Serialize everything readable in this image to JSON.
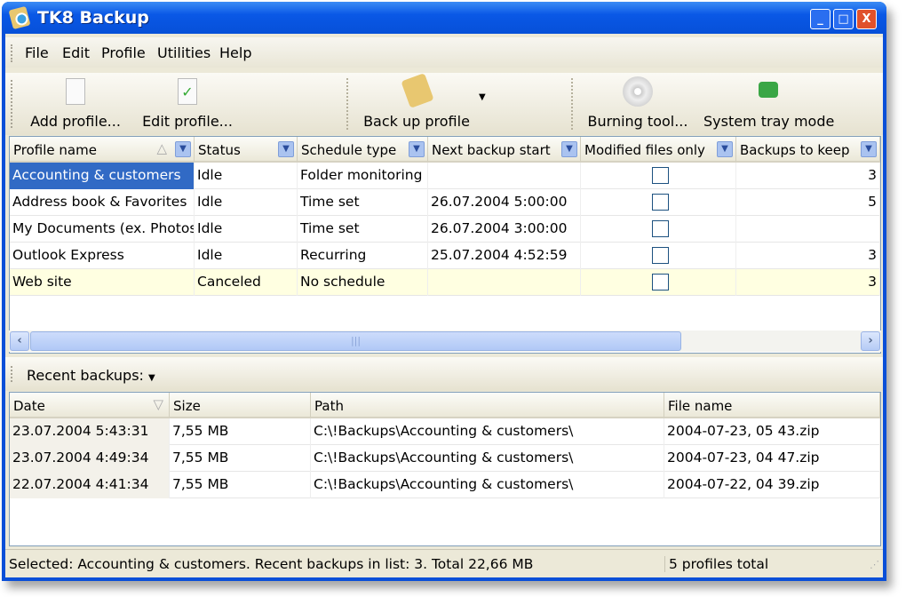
{
  "window": {
    "title": "TK8 Backup"
  },
  "menu": [
    "File",
    "Edit",
    "Profile",
    "Utilities",
    "Help"
  ],
  "toolbar": {
    "add": "Add profile...",
    "edit": "Edit profile...",
    "backup": "Back up profile",
    "burn": "Burning tool...",
    "tray": "System tray mode"
  },
  "profiles": {
    "columns": [
      "Profile name",
      "Status",
      "Schedule type",
      "Next backup start",
      "Modified files only",
      "Backups to keep"
    ],
    "rows": [
      {
        "name": "Accounting & customers",
        "status": "Idle",
        "schedule": "Folder monitoring",
        "next": "",
        "modified": false,
        "keep": "3",
        "selected": true
      },
      {
        "name": "Address book & Favorites",
        "status": "Idle",
        "schedule": "Time set",
        "next": "26.07.2004 5:00:00",
        "modified": false,
        "keep": "5"
      },
      {
        "name": "My Documents (ex. Photos",
        "status": "Idle",
        "schedule": "Time set",
        "next": "26.07.2004 3:00:00",
        "modified": false,
        "keep": ""
      },
      {
        "name": "Outlook Express",
        "status": "Idle",
        "schedule": "Recurring",
        "next": "25.07.2004 4:52:59",
        "modified": false,
        "keep": "3"
      },
      {
        "name": "Web site",
        "status": "Canceled",
        "schedule": "No schedule",
        "next": "",
        "modified": false,
        "keep": "3",
        "highlight": true
      }
    ]
  },
  "recent": {
    "label": "Recent backups:",
    "columns": [
      "Date",
      "Size",
      "Path",
      "File name"
    ],
    "rows": [
      [
        "23.07.2004 5:43:31",
        "7,55 MB",
        "C:\\!Backups\\Accounting & customers\\",
        "2004-07-23, 05 43.zip"
      ],
      [
        "23.07.2004 4:49:34",
        "7,55 MB",
        "C:\\!Backups\\Accounting & customers\\",
        "2004-07-23, 04 47.zip"
      ],
      [
        "22.07.2004 4:41:34",
        "7,55 MB",
        "C:\\!Backups\\Accounting & customers\\",
        "2004-07-22, 04 39.zip"
      ]
    ]
  },
  "status": {
    "left": "Selected: Accounting & customers.   Recent backups in list: 3.   Total 22,66 MB",
    "right": "5 profiles total"
  },
  "colors": {
    "titlebar": "#0a58e6",
    "selection": "#316ac5",
    "highlight_row": "#ffffe1"
  }
}
